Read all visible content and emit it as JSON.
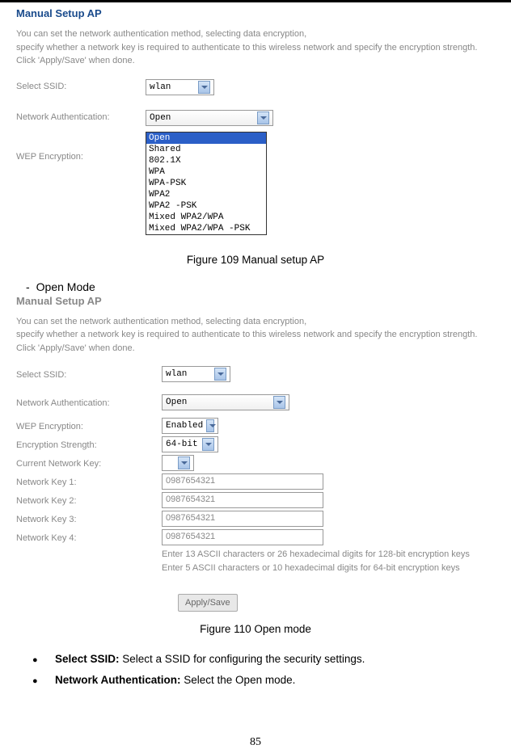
{
  "screenshot1": {
    "heading": "Manual Setup AP",
    "desc_line1": "You can set the network authentication method, selecting data encryption,",
    "desc_line2": "specify whether a network key is required to authenticate to this wireless network and specify the encryption strength.",
    "desc_line3": "Click 'Apply/Save' when done.",
    "ssid_label": "Select SSID:",
    "ssid_value": "wlan",
    "auth_label": "Network Authentication:",
    "auth_value": "Open",
    "wep_label": "WEP Encryption:",
    "options": [
      "Open",
      "Shared",
      "802.1X",
      "WPA",
      "WPA-PSK",
      "WPA2",
      "WPA2 -PSK",
      "Mixed WPA2/WPA",
      "Mixed WPA2/WPA -PSK"
    ]
  },
  "caption1": "Figure 109 Manual setup AP",
  "section_open": "Open Mode",
  "screenshot2": {
    "heading": "Manual Setup AP",
    "desc_line1": "You can set the network authentication method, selecting data encryption,",
    "desc_line2": "specify whether a network key is required to authenticate to this wireless network and specify the encryption strength.",
    "desc_line3": "Click 'Apply/Save' when done.",
    "ssid_label": "Select SSID:",
    "ssid_value": "wlan",
    "auth_label": "Network Authentication:",
    "auth_value": "Open",
    "wep_label": "WEP Encryption:",
    "wep_value": "Enabled",
    "strength_label": "Encryption Strength:",
    "strength_value": "64-bit",
    "current_key_label": "Current Network Key:",
    "key1_label": "Network Key 1:",
    "key2_label": "Network Key 2:",
    "key3_label": "Network Key 3:",
    "key4_label": "Network Key 4:",
    "key_value": "0987654321",
    "note1": "Enter 13 ASCII characters or 26 hexadecimal digits for 128-bit encryption keys",
    "note2": "Enter 5 ASCII characters or 10 hexadecimal digits for 64-bit encryption keys",
    "apply": "Apply/Save"
  },
  "caption2": "Figure 110 Open mode",
  "bullet1_bold": "Select SSID: ",
  "bullet1_text": "Select a SSID for configuring the security settings.",
  "bullet2_bold": "Network Authentication: ",
  "bullet2_text": "Select the Open mode.",
  "page_num": "85"
}
